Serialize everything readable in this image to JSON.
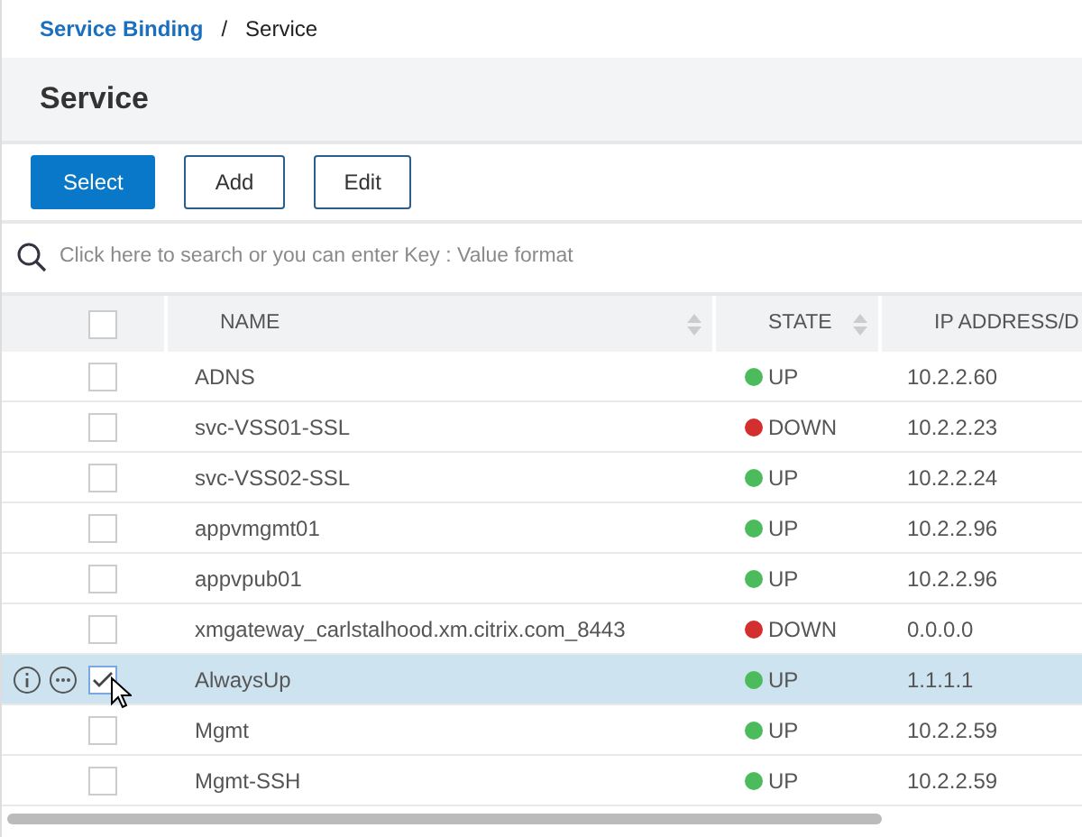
{
  "breadcrumb_separator": "/",
  "breadcrumb": [
    {
      "label": "Service Binding",
      "link": true
    },
    {
      "label": "Service",
      "link": false
    }
  ],
  "title": "Service",
  "buttons": [
    {
      "label": "Select",
      "primary": true
    },
    {
      "label": "Add",
      "primary": false
    },
    {
      "label": "Edit",
      "primary": false
    }
  ],
  "search": {
    "placeholder": "Click here to search or you can enter Key : Value format"
  },
  "table": {
    "header_checked": false,
    "columns": [
      "NAME",
      "STATE",
      "IP ADDRESS/D"
    ],
    "rows": [
      {
        "name": "ADNS",
        "state": "UP",
        "color": "#4cbb5c",
        "ip": "10.2.2.60",
        "selected": false
      },
      {
        "name": "svc-VSS01-SSL",
        "state": "DOWN",
        "color": "#d32f2f",
        "ip": "10.2.2.23",
        "selected": false
      },
      {
        "name": "svc-VSS02-SSL",
        "state": "UP",
        "color": "#4cbb5c",
        "ip": "10.2.2.24",
        "selected": false
      },
      {
        "name": "appvmgmt01",
        "state": "UP",
        "color": "#4cbb5c",
        "ip": "10.2.2.96",
        "selected": false
      },
      {
        "name": "appvpub01",
        "state": "UP",
        "color": "#4cbb5c",
        "ip": "10.2.2.96",
        "selected": false
      },
      {
        "name": "xmgateway_carlstalhood.xm.citrix.com_8443",
        "state": "DOWN",
        "color": "#d32f2f",
        "ip": "0.0.0.0",
        "selected": false
      },
      {
        "name": "AlwaysUp",
        "state": "UP",
        "color": "#4cbb5c",
        "ip": "1.1.1.1",
        "selected": true
      },
      {
        "name": "Mgmt",
        "state": "UP",
        "color": "#4cbb5c",
        "ip": "10.2.2.59",
        "selected": false
      },
      {
        "name": "Mgmt-SSH",
        "state": "UP",
        "color": "#4cbb5c",
        "ip": "10.2.2.59",
        "selected": false
      }
    ]
  }
}
